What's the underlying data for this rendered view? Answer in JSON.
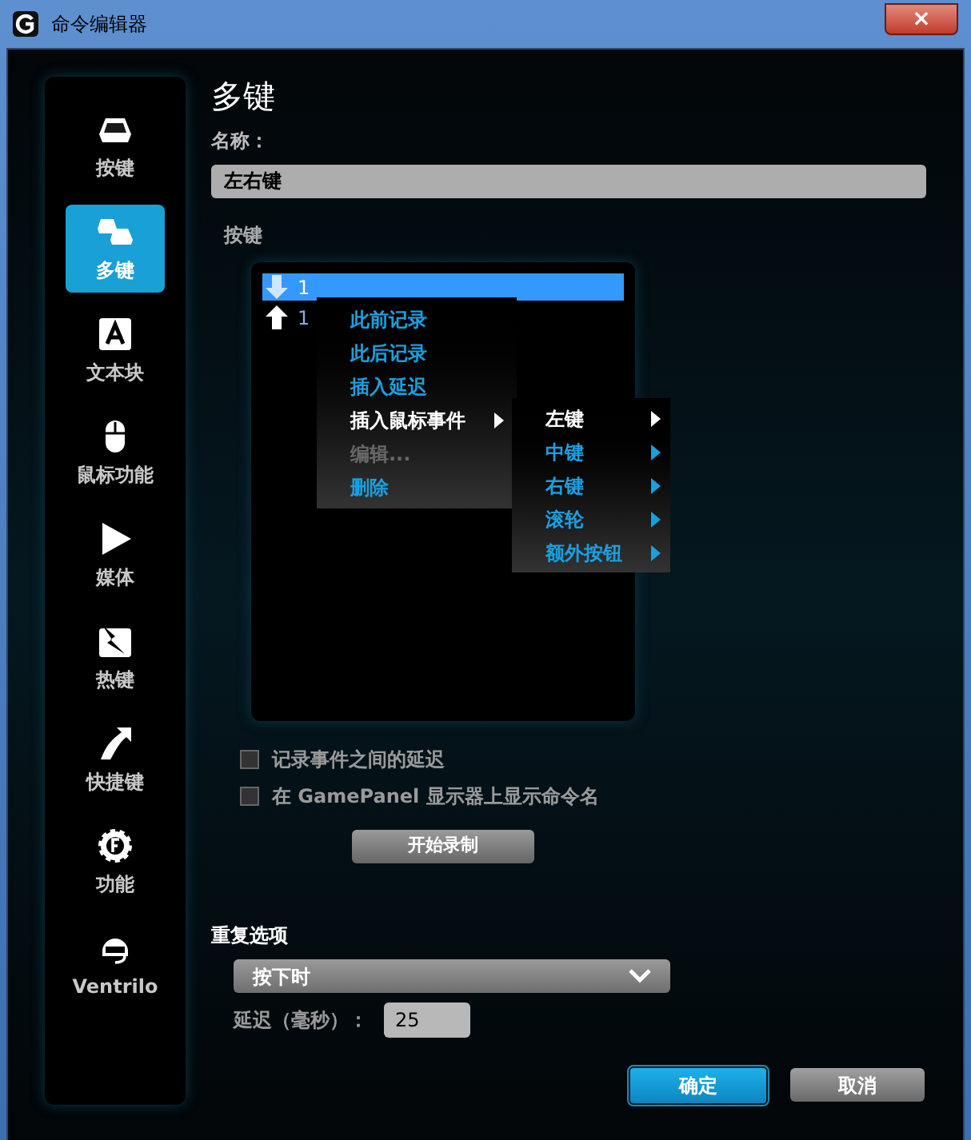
{
  "window": {
    "title": "命令编辑器",
    "close": "×"
  },
  "sidebar": {
    "items": [
      {
        "label": "按键",
        "selected": false
      },
      {
        "label": "多键",
        "selected": true
      },
      {
        "label": "文本块",
        "selected": false
      },
      {
        "label": "鼠标功能",
        "selected": false
      },
      {
        "label": "媒体",
        "selected": false
      },
      {
        "label": "热键",
        "selected": false
      },
      {
        "label": "快捷键",
        "selected": false
      },
      {
        "label": "功能",
        "selected": false
      },
      {
        "label": "Ventrilo",
        "selected": false
      }
    ]
  },
  "heading": "多键",
  "name_field": {
    "label": "名称：",
    "value": "左右键"
  },
  "keys": {
    "label": "按键",
    "rows": [
      {
        "text": "1",
        "kind": "down",
        "selected": true
      },
      {
        "text": "1",
        "kind": "up",
        "selected": false
      }
    ]
  },
  "context_menu": {
    "items": [
      {
        "label": "此前记录",
        "selected": false,
        "disabled": false,
        "submenu": false
      },
      {
        "label": "此后记录",
        "selected": false,
        "disabled": false,
        "submenu": false
      },
      {
        "label": "插入延迟",
        "selected": false,
        "disabled": false,
        "submenu": false
      },
      {
        "label": "插入鼠标事件",
        "selected": true,
        "disabled": false,
        "submenu": true
      },
      {
        "label": "编辑...",
        "selected": false,
        "disabled": true,
        "submenu": false
      },
      {
        "label": "删除",
        "selected": false,
        "disabled": false,
        "submenu": false
      }
    ]
  },
  "submenu": {
    "items": [
      {
        "label": "左键",
        "selected": true
      },
      {
        "label": "中键",
        "selected": false
      },
      {
        "label": "右键",
        "selected": false
      },
      {
        "label": "滚轮",
        "selected": false
      },
      {
        "label": "额外按钮",
        "selected": false
      }
    ]
  },
  "options": [
    {
      "label": "记录事件之间的延迟",
      "checked": false
    },
    {
      "label": "在 GamePanel 显示器上显示命令名",
      "checked": false
    }
  ],
  "record_button": "开始录制",
  "repeat": {
    "label": "重复选项",
    "value": "按下时",
    "delay_label": "延迟（毫秒）：",
    "delay_value": "25"
  },
  "buttons": {
    "ok": "确定",
    "cancel": "取消"
  }
}
